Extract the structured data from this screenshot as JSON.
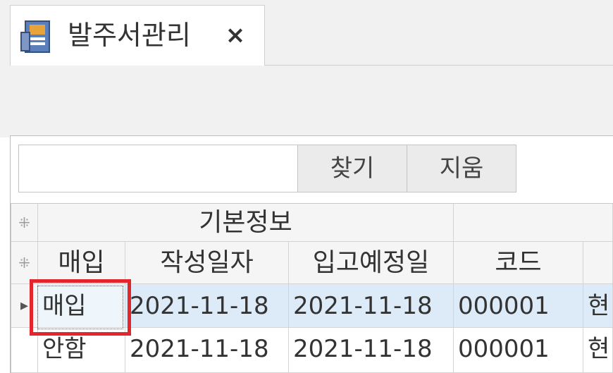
{
  "tab": {
    "title": "발주서관리",
    "close_glyph": "×"
  },
  "search": {
    "value": "",
    "placeholder": "",
    "find_label": "찾기",
    "clear_label": "지움"
  },
  "grid": {
    "band_indicator": "⁜",
    "header_indicator": "⁜",
    "band_title": "기본정보",
    "columns": [
      "매입",
      "작성일자",
      "입고예정일",
      "코드",
      ""
    ],
    "rows": [
      {
        "indicator": "▸",
        "cells": [
          "매입",
          "2021-11-18",
          "2021-11-18",
          "000001",
          "현"
        ]
      },
      {
        "indicator": "",
        "cells": [
          "안함",
          "2021-11-18",
          "2021-11-18",
          "000001",
          "현"
        ]
      }
    ],
    "selected_row_color": "#dcebf7",
    "focus_outline_color": "#e3262b"
  },
  "icons": {
    "tab": "document-form-icon",
    "close": "close-icon",
    "row_pointer": "row-pointer-icon",
    "band_indicator": "asterisk-icon"
  }
}
